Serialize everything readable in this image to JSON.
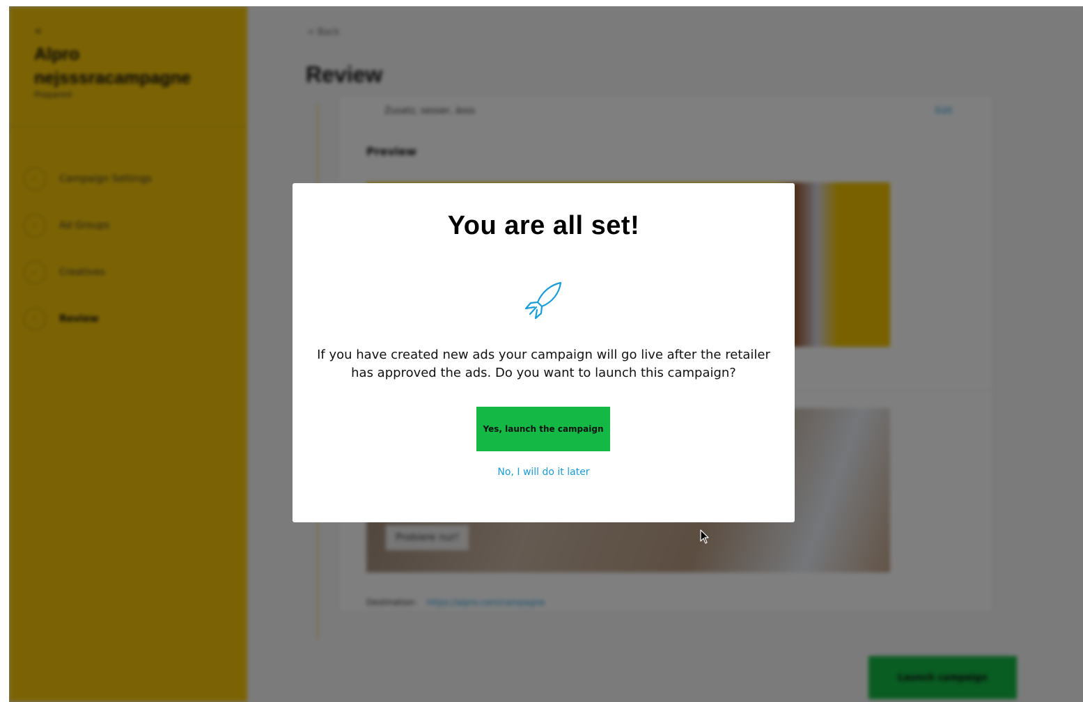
{
  "sidebar": {
    "back_arrow": "<",
    "title": "Alpro nejsssracampagne",
    "status": "Prepared",
    "steps": [
      {
        "label": "Campaign Settings",
        "icon": "check-icon"
      },
      {
        "label": "Ad Groups",
        "icon": "check-icon"
      },
      {
        "label": "Creatives",
        "icon": "check-icon"
      },
      {
        "label": "Review",
        "icon": "dot-icon"
      }
    ]
  },
  "main": {
    "back_link": "< Back",
    "page_title": "Review",
    "card": {
      "subtitle": "Zusatz, sesser, ässs",
      "edit_label": "Edit",
      "preview_label": "Preview",
      "ad_tag": "Probiere nur!",
      "destination_label": "Destination:",
      "destination_url": "https://alpro.com/campagne"
    },
    "bottom_button_label": "Launch campaign"
  },
  "modal": {
    "title": "You are all set!",
    "icon": "rocket-icon",
    "message": "If you have created new ads your campaign will go live after the retailer has approved the ads. Do you want to launch this campaign?",
    "confirm_label": "Yes, launch the campaign",
    "cancel_label": "No, I will do it later"
  },
  "colors": {
    "accent_yellow": "#f7c70b",
    "confirm_green": "#13b845",
    "link_blue": "#1a9cd8"
  }
}
